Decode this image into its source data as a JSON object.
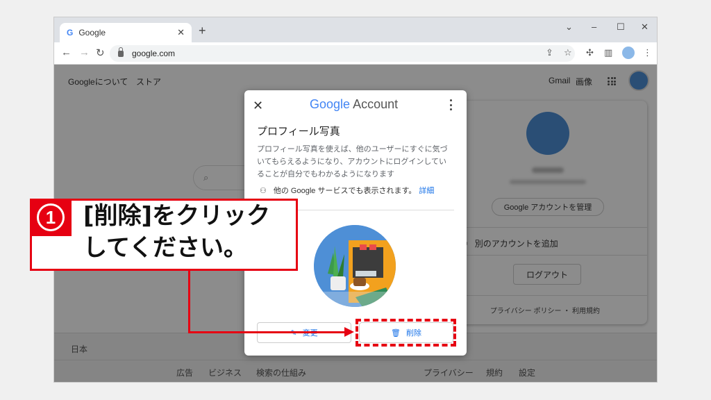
{
  "browser": {
    "tab_title": "Google",
    "tab_favicon": "G",
    "new_tab": "+",
    "url": "google.com"
  },
  "page": {
    "about": "Googleについて",
    "store": "ストア",
    "gmail": "Gmail",
    "images": "画像",
    "country": "日本",
    "footer_links": [
      "広告",
      "ビジネス",
      "検索の仕組み",
      "プライバシー",
      "規約",
      "設定"
    ]
  },
  "account_panel": {
    "manage": "Google アカウントを管理",
    "add_account": "別のアカウントを追加",
    "logout": "ログアウト",
    "footer": "プライバシー ポリシー ・ 利用規約"
  },
  "dialog": {
    "brand_google": "Google",
    "brand_account": "Account",
    "title": "プロフィール写真",
    "description": "プロフィール写真を使えば、他のユーザーにすぐに気づいてもらえるようになり、アカウントにログインしていることが自分でもわかるようになります",
    "visibility": "他の Google サービスでも表示されます。",
    "details_link": "詳細",
    "change_label": "変更",
    "delete_label": "削除"
  },
  "annotation": {
    "step_number": "1",
    "instruction_line1": "[削除]をクリック",
    "instruction_line2": "してください。",
    "accent_color": "#e60012"
  }
}
